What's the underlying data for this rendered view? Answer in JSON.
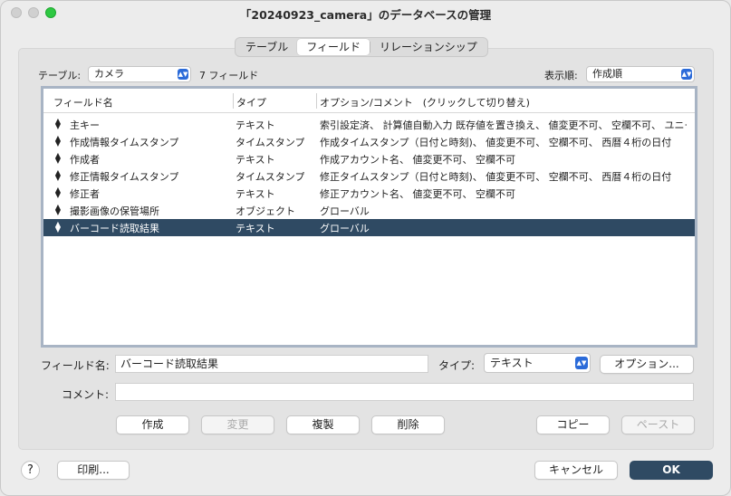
{
  "window": {
    "title": "「20240923_camera」のデータベースの管理"
  },
  "tabs": [
    {
      "label": "テーブル",
      "active": false
    },
    {
      "label": "フィールド",
      "active": true
    },
    {
      "label": "リレーションシップ",
      "active": false
    }
  ],
  "table_selector": {
    "label": "テーブル:",
    "value": "カメラ",
    "count": "7 フィールド"
  },
  "sort": {
    "label": "表示順:",
    "value": "作成順"
  },
  "columns": {
    "name": "フィールド名",
    "type": "タイプ",
    "options": "オプション/コメント　(クリックして切り替え)"
  },
  "fields": [
    {
      "name": "主キー",
      "type": "テキスト",
      "options": "索引設定済、 計算値自動入力  既存値を置き換え、 値変更不可、 空欄不可、 ユニーク…",
      "selected": false
    },
    {
      "name": "作成情報タイムスタンプ",
      "type": "タイムスタンプ",
      "options": "作成タイムスタンプ（日付と時刻)、 値変更不可、 空欄不可、 西暦４桁の日付",
      "selected": false
    },
    {
      "name": "作成者",
      "type": "テキスト",
      "options": "作成アカウント名、 値変更不可、 空欄不可",
      "selected": false
    },
    {
      "name": "修正情報タイムスタンプ",
      "type": "タイムスタンプ",
      "options": "修正タイムスタンプ（日付と時刻)、 値変更不可、 空欄不可、 西暦４桁の日付",
      "selected": false
    },
    {
      "name": "修正者",
      "type": "テキスト",
      "options": "修正アカウント名、 値変更不可、 空欄不可",
      "selected": false
    },
    {
      "name": "撮影画像の保管場所",
      "type": "オブジェクト",
      "options": "グローバル",
      "selected": false
    },
    {
      "name": "バーコード読取結果",
      "type": "テキスト",
      "options": "グローバル",
      "selected": true
    }
  ],
  "editor": {
    "field_name_label": "フィールド名:",
    "field_name_value": "バーコード読取結果",
    "type_label": "タイプ:",
    "type_value": "テキスト",
    "options_button": "オプション...",
    "comment_label": "コメント:",
    "comment_value": ""
  },
  "action_buttons": {
    "create": "作成",
    "change": "変更",
    "duplicate": "複製",
    "delete": "削除",
    "copy": "コピー",
    "paste": "ペースト"
  },
  "footer": {
    "help": "?",
    "print": "印刷...",
    "cancel": "キャンセル",
    "ok": "OK"
  },
  "icons": {
    "row_handle": "drag-handle-icon",
    "popup_arrow": "updown-chevron-icon"
  },
  "colors": {
    "selection": "#2f4a63",
    "accent": "#2b6bd9",
    "maximize": "#2ec842"
  }
}
